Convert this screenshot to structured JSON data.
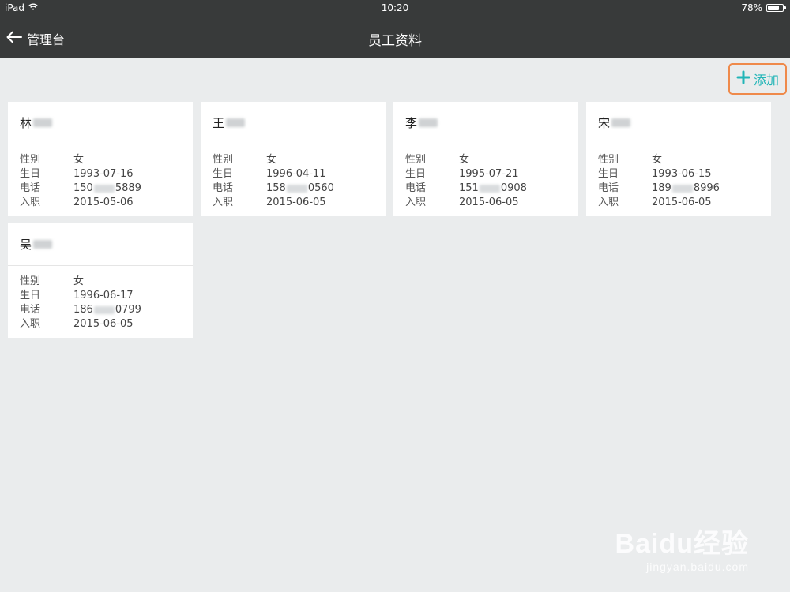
{
  "status_bar": {
    "device": "iPad",
    "time": "10:20",
    "battery": "78%",
    "battery_level": 0.78
  },
  "nav": {
    "back_label": "管理台",
    "title": "员工资料"
  },
  "toolbar": {
    "add_label": "添加"
  },
  "labels": {
    "gender": "性别",
    "birthday": "生日",
    "phone": "电话",
    "joined": "入职"
  },
  "employees": [
    {
      "surname": "林",
      "gender": "女",
      "birthday": "1993-07-16",
      "phone_prefix": "150",
      "phone_suffix": "5889",
      "joined": "2015-05-06"
    },
    {
      "surname": "王",
      "gender": "女",
      "birthday": "1996-04-11",
      "phone_prefix": "158",
      "phone_suffix": "0560",
      "joined": "2015-06-05"
    },
    {
      "surname": "李",
      "gender": "女",
      "birthday": "1995-07-21",
      "phone_prefix": "151",
      "phone_suffix": "0908",
      "joined": "2015-06-05"
    },
    {
      "surname": "宋",
      "gender": "女",
      "birthday": "1993-06-15",
      "phone_prefix": "189",
      "phone_suffix": "8996",
      "joined": "2015-06-05"
    },
    {
      "surname": "吴",
      "gender": "女",
      "birthday": "1996-06-17",
      "phone_prefix": "186",
      "phone_suffix": "0799",
      "joined": "2015-06-05"
    }
  ],
  "watermark": {
    "brand": "Baidu经验",
    "url": "jingyan.baidu.com"
  }
}
